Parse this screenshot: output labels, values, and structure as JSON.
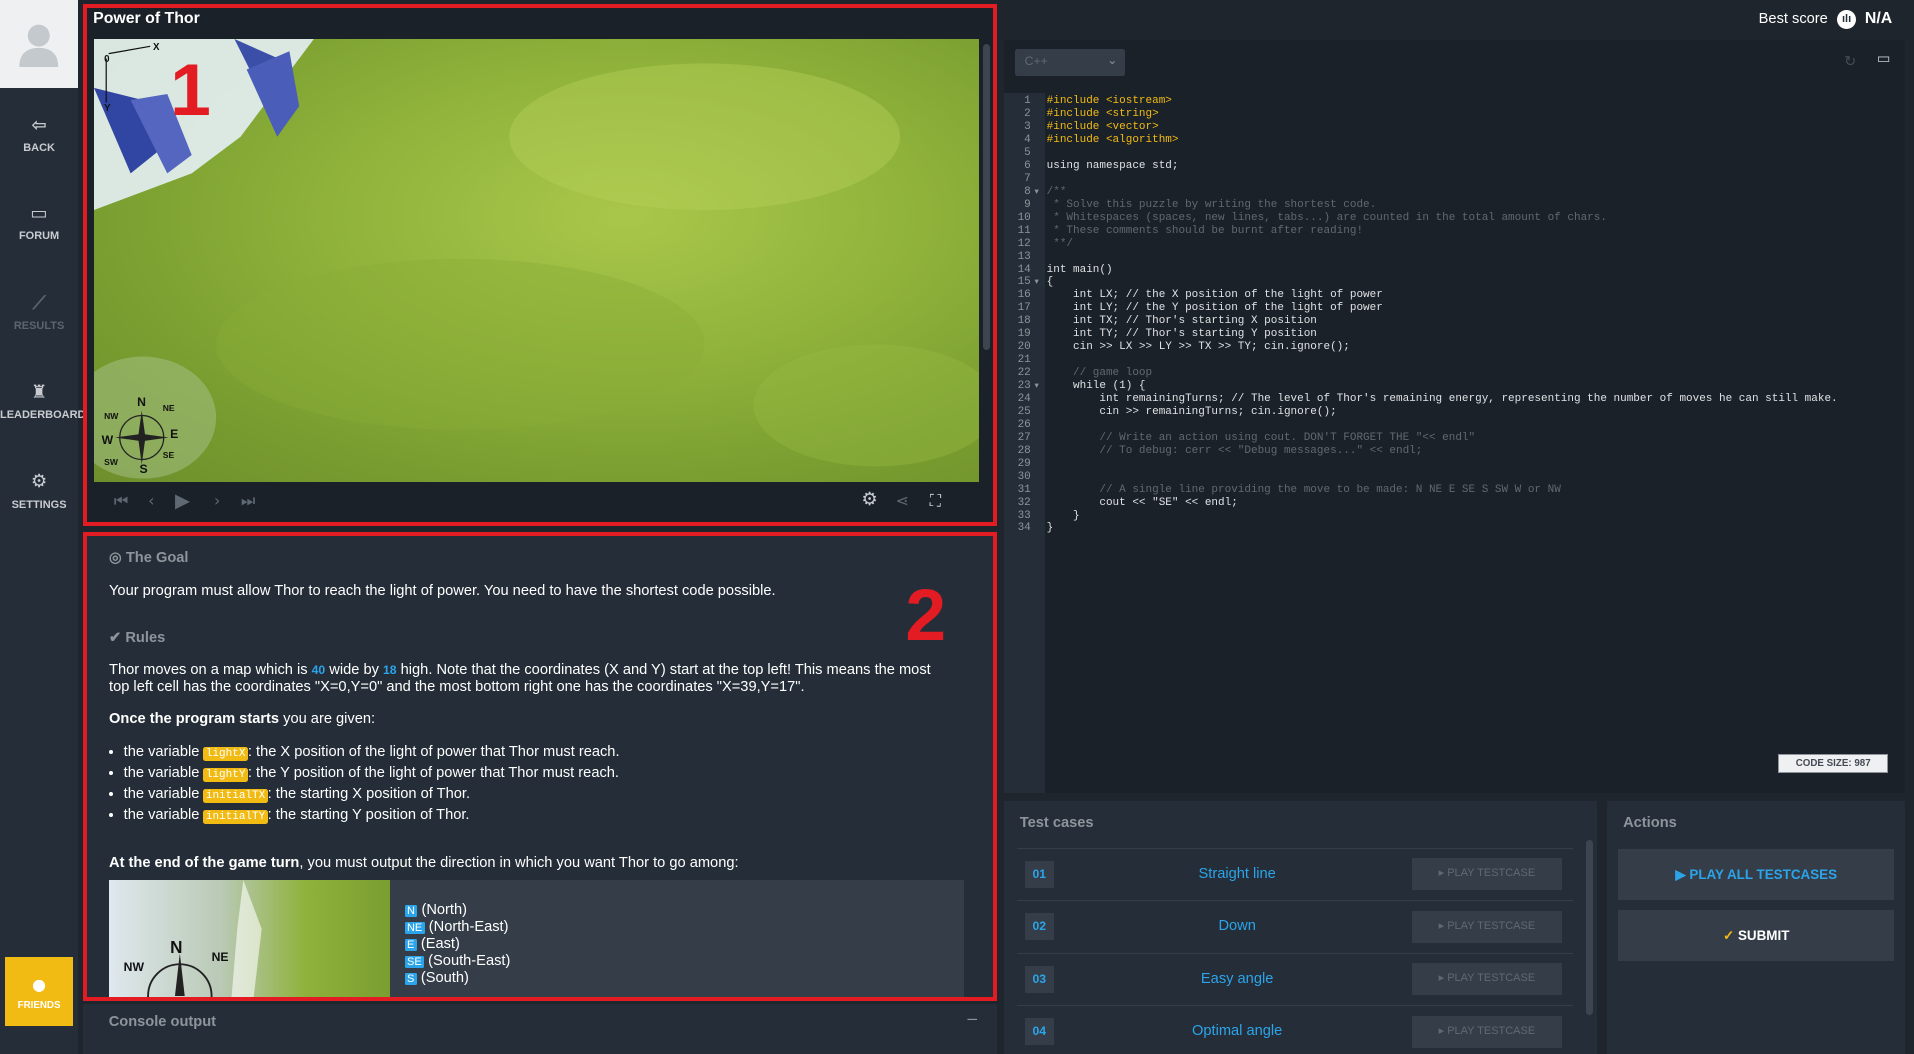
{
  "sidebar": {
    "items": [
      {
        "label": "BACK",
        "icon": "arrow-left-icon"
      },
      {
        "label": "FORUM",
        "icon": "forum-icon"
      },
      {
        "label": "RESULTS",
        "icon": "chart-icon"
      },
      {
        "label": "LEADERBOARD",
        "icon": "trophy-icon"
      },
      {
        "label": "SETTINGS",
        "icon": "gear-icon"
      }
    ],
    "friends_label": "FRIENDS"
  },
  "viewer": {
    "title": "Power of Thor",
    "annotation": "1",
    "axis_x": "X",
    "axis_y": "Y",
    "axis_origin": "0",
    "compass": {
      "n": "N",
      "ne": "NE",
      "nw": "NW",
      "e": "E",
      "w": "W",
      "se": "SE",
      "sw": "SW",
      "s": "S"
    }
  },
  "statement": {
    "annotation": "2",
    "goal_title": "The Goal",
    "goal_text": "Your program must allow Thor to reach the light of power. You need to have the shortest code possible.",
    "rules_title": "Rules",
    "rules_p1a": "Thor moves on a map which is ",
    "width": "40",
    "rules_p1b": " wide by ",
    "height": "18",
    "rules_p1c": " high. Note that the coordinates (X and Y) start at the top left! This means the most",
    "rules_p1d": "top left cell has the coordinates \"X=0,Y=0\" and the most bottom right one has the coordinates \"X=39,Y=17\".",
    "starts_bold": "Once the program starts",
    "starts_rest": " you are given:",
    "vars": [
      {
        "pre": "the variable ",
        "name": "lightX",
        "post": ": the X position of the light of power that Thor must reach."
      },
      {
        "pre": "the variable ",
        "name": "lightY",
        "post": ": the Y position of the light of power that Thor must reach."
      },
      {
        "pre": "the variable ",
        "name": "initialTX",
        "post": ": the starting X position of Thor."
      },
      {
        "pre": "the variable ",
        "name": "initialTY",
        "post": ": the starting Y position of Thor."
      }
    ],
    "end_bold": "At the end of the game turn",
    "end_rest": ", you must output the direction in which you want Thor to go among:",
    "directions": [
      {
        "tag": "N",
        "label": " (North)"
      },
      {
        "tag": "NE",
        "label": " (North-East)"
      },
      {
        "tag": "E",
        "label": " (East)"
      },
      {
        "tag": "SE",
        "label": " (South-East)"
      },
      {
        "tag": "S",
        "label": " (South)"
      }
    ],
    "img_compass": {
      "n": "N",
      "ne": "NE",
      "nw": "NW"
    }
  },
  "console": {
    "title": "Console output",
    "minimize": "–"
  },
  "header": {
    "best_score_label": "Best score",
    "best_score_value": "N/A"
  },
  "editor": {
    "language": "C++",
    "code_size_label": "CODE SIZE:",
    "code_size_value": "987",
    "lines": [
      "#include <iostream>",
      "#include <string>",
      "#include <vector>",
      "#include <algorithm>",
      "",
      "using namespace std;",
      "",
      "/**",
      " * Solve this puzzle by writing the shortest code.",
      " * Whitespaces (spaces, new lines, tabs...) are counted in the total amount of chars.",
      " * These comments should be burnt after reading!",
      " **/",
      "",
      "int main()",
      "{",
      "    int LX; // the X position of the light of power",
      "    int LY; // the Y position of the light of power",
      "    int TX; // Thor's starting X position",
      "    int TY; // Thor's starting Y position",
      "    cin >> LX >> LY >> TX >> TY; cin.ignore();",
      "",
      "    // game loop",
      "    while (1) {",
      "        int remainingTurns; // The level of Thor's remaining energy, representing the number of moves he can still make.",
      "        cin >> remainingTurns; cin.ignore();",
      "",
      "        // Write an action using cout. DON'T FORGET THE \"<< endl\"",
      "        // To debug: cerr << \"Debug messages...\" << endl;",
      "",
      "",
      "        // A single line providing the move to be made: N NE E SE S SW W or NW",
      "        cout << \"SE\" << endl;",
      "    }",
      "}"
    ],
    "fold_markers": [
      "8",
      "15",
      "23"
    ]
  },
  "tests": {
    "title": "Test cases",
    "items": [
      {
        "num": "01",
        "name": "Straight line",
        "button": "PLAY TESTCASE"
      },
      {
        "num": "02",
        "name": "Down",
        "button": "PLAY TESTCASE"
      },
      {
        "num": "03",
        "name": "Easy angle",
        "button": "PLAY TESTCASE"
      },
      {
        "num": "04",
        "name": "Optimal angle",
        "button": "PLAY TESTCASE"
      }
    ]
  },
  "actions": {
    "title": "Actions",
    "play_all": "PLAY ALL TESTCASES",
    "submit": "SUBMIT"
  },
  "colors": {
    "accent_blue": "#2ba4ea",
    "accent_yellow": "#f2bb13",
    "highlight_red": "#e31b23"
  }
}
